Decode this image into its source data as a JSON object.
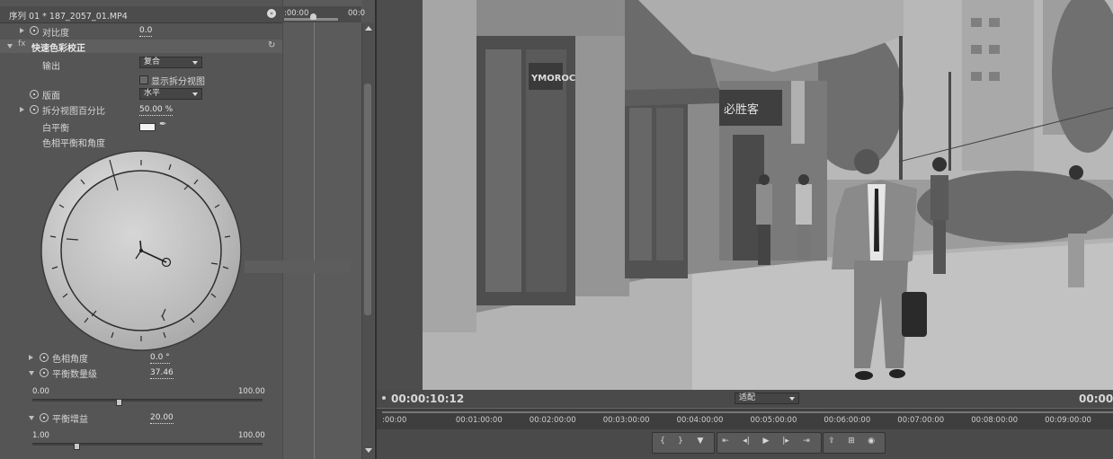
{
  "effect_controls": {
    "header_title": "序列 01 * 187_2057_01.MP4",
    "timeline": {
      "start_time": ":00:00",
      "end_time": "00:0"
    },
    "contrast": {
      "label": "对比度",
      "value": "0.0"
    },
    "section_title": "快速色彩校正",
    "output": {
      "label": "输出",
      "value": "复合"
    },
    "split_view": {
      "label": "显示拆分视图"
    },
    "layout": {
      "label": "版面",
      "value": "水平"
    },
    "split_percent": {
      "label": "拆分视图百分比",
      "value": "50.00 %"
    },
    "white_balance": {
      "label": "白平衡"
    },
    "hue_balance_angle": {
      "label": "色相平衡和角度"
    },
    "hue_angle": {
      "label": "色相角度",
      "value": "0.0 °"
    },
    "balance_magnitude": {
      "label": "平衡数量级",
      "value": "37.46",
      "min": "0.00",
      "max": "100.00",
      "level": 0.3746
    },
    "balance_gain": {
      "label": "平衡增益",
      "value": "20.00",
      "min": "1.00",
      "max": "100.00",
      "level": 0.19
    }
  },
  "program_monitor": {
    "timecode": "00:00:10:12",
    "timecode_right": "00:00:",
    "zoom": "适配",
    "ruler_ticks": [
      ":00:00",
      "00:01:00:00",
      "00:02:00:00",
      "00:03:00:00",
      "00:04:00:00",
      "00:05:00:00",
      "00:06:00:00",
      "00:07:00:00",
      "00:08:00:00",
      "00:09:00:00",
      "00:1"
    ],
    "video_signs": {
      "store_left": "YMOROC",
      "store_right": "必胜客"
    }
  },
  "transport_icons": [
    "mark-in-icon",
    "mark-out-icon",
    "add-marker-icon",
    "go-to-in-icon",
    "step-back-icon",
    "play-icon",
    "step-forward-icon",
    "go-to-out-icon",
    "lift-icon",
    "extract-icon",
    "export-frame-icon"
  ],
  "colors": {
    "panel": "#555555",
    "monitor": "#4d4d4d",
    "accent_text": "#e6e6e6"
  }
}
